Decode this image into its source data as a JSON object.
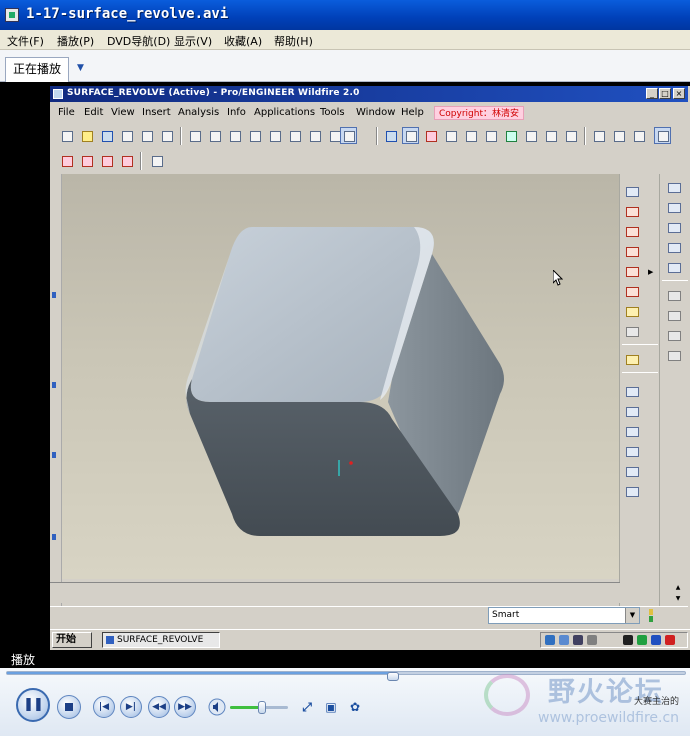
{
  "player": {
    "title": "1-17-surface_revolve.avi",
    "menu": [
      "文件(F)",
      "播放(P)",
      "DVD导航(D)",
      "显示(V)",
      "收藏(A)",
      "帮助(H)"
    ],
    "tab_now_playing": "正在播放",
    "status_label": "播放",
    "seek_progress_pct": 57,
    "volume_pct": 55
  },
  "proe": {
    "title": "SURFACE_REVOLVE (Active) - Pro/ENGINEER Wildfire 2.0",
    "menu": [
      "File",
      "Edit",
      "View",
      "Insert",
      "Analysis",
      "Info",
      "Applications",
      "Tools",
      "Window",
      "Help"
    ],
    "copyright": "Copyright：林清安",
    "window_buttons": [
      "_",
      "□",
      "×"
    ],
    "filter_value": "Smart"
  },
  "taskbar": {
    "start_label": "开始",
    "task_item": "SURFACE_REVOLVE"
  },
  "watermark": {
    "forum_name": "野火论坛",
    "forum_url": "www.proewildfire.cn",
    "side_text": "大赛主治的"
  },
  "colors": {
    "player_title_bg": "#0a5ddc",
    "proe_title_bg": "#102a80",
    "viewport_bg": "#cac6b6",
    "model_top": "#b5c0ca",
    "model_front": "#4a5258",
    "model_right": "#7a848c",
    "copyright_text": "#d00000"
  }
}
